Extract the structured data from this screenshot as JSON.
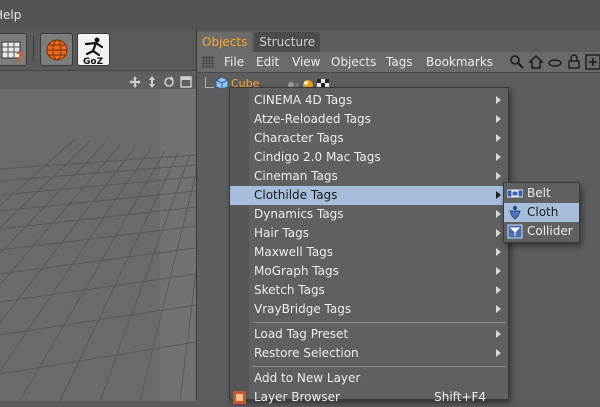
{
  "menubar": {
    "help_label": "Help"
  },
  "toolbar": {
    "buttons": [
      {
        "icon": "render-settings-icon"
      },
      {
        "icon": "globe-icon"
      },
      {
        "icon": "goz-icon",
        "label": "GoZ"
      }
    ]
  },
  "object_manager": {
    "tabs": [
      {
        "label": "Objects",
        "active": true
      },
      {
        "label": "Structure",
        "active": false
      }
    ],
    "menu": [
      "File",
      "Edit",
      "View",
      "Objects",
      "Tags",
      "Bookmarks"
    ],
    "object_name": "Cube"
  },
  "context_menu": {
    "items": [
      {
        "label": "CINEMA 4D Tags",
        "submenu": true
      },
      {
        "label": "Atze-Reloaded Tags",
        "submenu": true
      },
      {
        "label": "Character Tags",
        "submenu": true
      },
      {
        "label": "Cindigo 2.0 Mac Tags",
        "submenu": true
      },
      {
        "label": "Cineman Tags",
        "submenu": true
      },
      {
        "label": "Clothilde Tags",
        "submenu": true,
        "highlighted": true
      },
      {
        "label": "Dynamics Tags",
        "submenu": true
      },
      {
        "label": "Hair Tags",
        "submenu": true
      },
      {
        "label": "Maxwell Tags",
        "submenu": true
      },
      {
        "label": "MoGraph Tags",
        "submenu": true
      },
      {
        "label": "Sketch Tags",
        "submenu": true
      },
      {
        "label": "VrayBridge Tags",
        "submenu": true
      }
    ],
    "group2": [
      {
        "label": "Load Tag Preset",
        "submenu": true
      },
      {
        "label": "Restore Selection",
        "submenu": true
      }
    ],
    "group3": [
      {
        "label": "Add to New Layer"
      },
      {
        "label": "Layer Browser",
        "shortcut": "Shift+F4"
      }
    ]
  },
  "submenu": {
    "items": [
      {
        "label": "Belt",
        "icon": "belt-tag-icon"
      },
      {
        "label": "Cloth",
        "icon": "cloth-tag-icon",
        "highlighted": true
      },
      {
        "label": "Collider",
        "icon": "collider-tag-icon"
      }
    ]
  },
  "colors": {
    "highlight": "#a6bedc",
    "active_tab_text": "#ffa626",
    "panel_bg": "#5d5d5d"
  }
}
